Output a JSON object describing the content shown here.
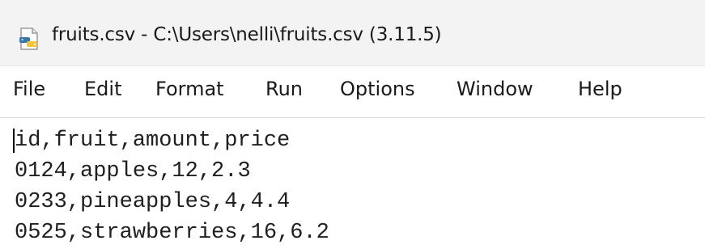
{
  "window": {
    "title": "fruits.csv - C:\\Users\\nelli\\fruits.csv (3.11.5)",
    "icon": "python-file-icon"
  },
  "menu": {
    "file": "File",
    "edit": "Edit",
    "format": "Format",
    "run": "Run",
    "options": "Options",
    "window": "Window",
    "help": "Help"
  },
  "editor": {
    "lines": [
      "id,fruit,amount,price",
      "0124,apples,12,2.3",
      "0233,pineapples,4,4.4",
      "0525,strawberries,16,6.2"
    ]
  }
}
